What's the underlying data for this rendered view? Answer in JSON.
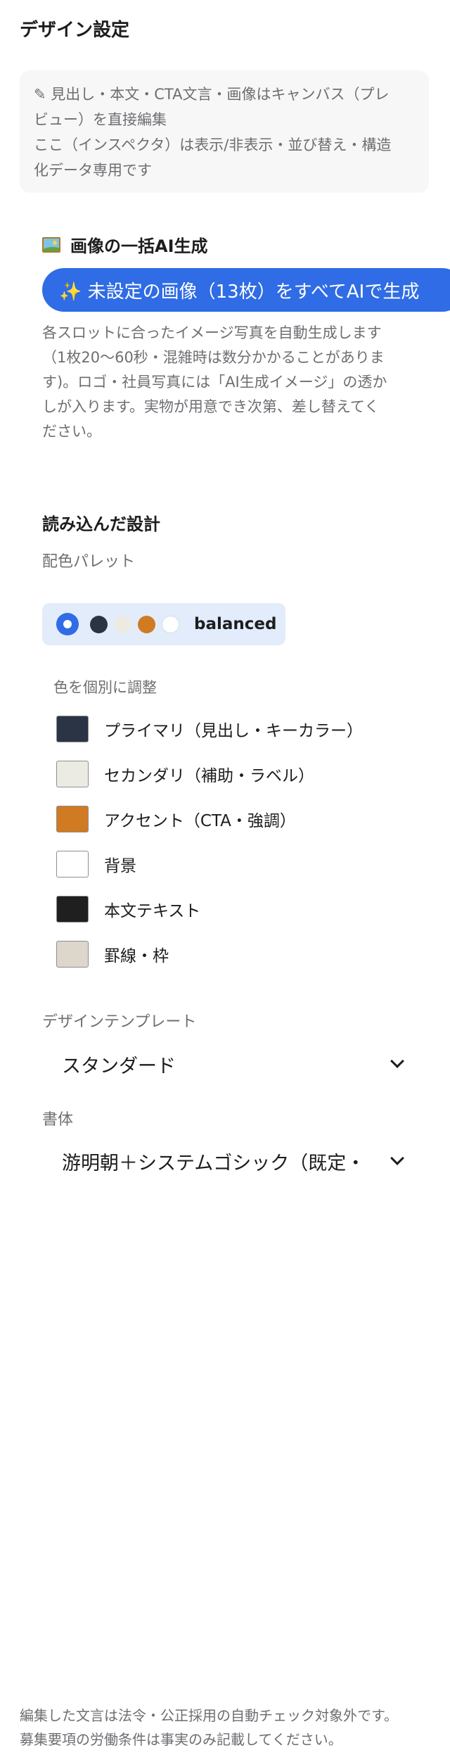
{
  "page_title": "デザイン設定",
  "note": {
    "line1": "✎ 見出し・本文・CTA文言・画像はキャンバス（プレ",
    "line2": "ビュー）を直接編集",
    "line3": "ここ（インスペクタ）は表示/非表示・並び替え・構造",
    "line4": "化データ専用です"
  },
  "ai_section": {
    "title": "画像の一括AI生成",
    "icon": "framed-picture-icon",
    "button_label": "✨ 未設定の画像（13枚）をすべてAIで生成",
    "button_icon": "sparkle-icon",
    "desc_line1": "各スロットに合ったイメージ写真を自動生成します",
    "desc_line2": "（1枚20〜60秒・混雑時は数分かかることがありま",
    "desc_line3": "す)。ロゴ・社員写真には「AI生成イメージ」の透か",
    "desc_line4": "しが入ります。実物が用意でき次第、差し替えてく",
    "desc_line5": "ださい。"
  },
  "design_section": {
    "title": "読み込んだ設計",
    "palette_label": "配色パレット",
    "palette": {
      "name": "balanced",
      "dots": [
        "#2b3445",
        "#ecebe3",
        "#d07a22",
        "#ffffff"
      ]
    },
    "adjust_label": "色を個別に調整",
    "colors": [
      {
        "label": "プライマリ（見出し・キーカラー）",
        "hex": "#2b3445"
      },
      {
        "label": "セカンダリ（補助・ラベル）",
        "hex": "#ecebe3"
      },
      {
        "label": "アクセント（CTA・強調）",
        "hex": "#d07a22"
      },
      {
        "label": "背景",
        "hex": "#ffffff"
      },
      {
        "label": "本文テキスト",
        "hex": "#1f1f1f"
      },
      {
        "label": "罫線・枠",
        "hex": "#ddd6ca"
      }
    ],
    "template_label": "デザインテンプレート",
    "template_value": "スタンダード",
    "font_label": "書体",
    "font_value": "游明朝＋システムゴシック（既定・"
  },
  "footer": {
    "line1": "編集した文言は法令・公正採用の自動チェック対象外です。",
    "line2": "募集要項の労働条件は事実のみ記載してください。"
  },
  "accent_color": "#2f6ce5"
}
